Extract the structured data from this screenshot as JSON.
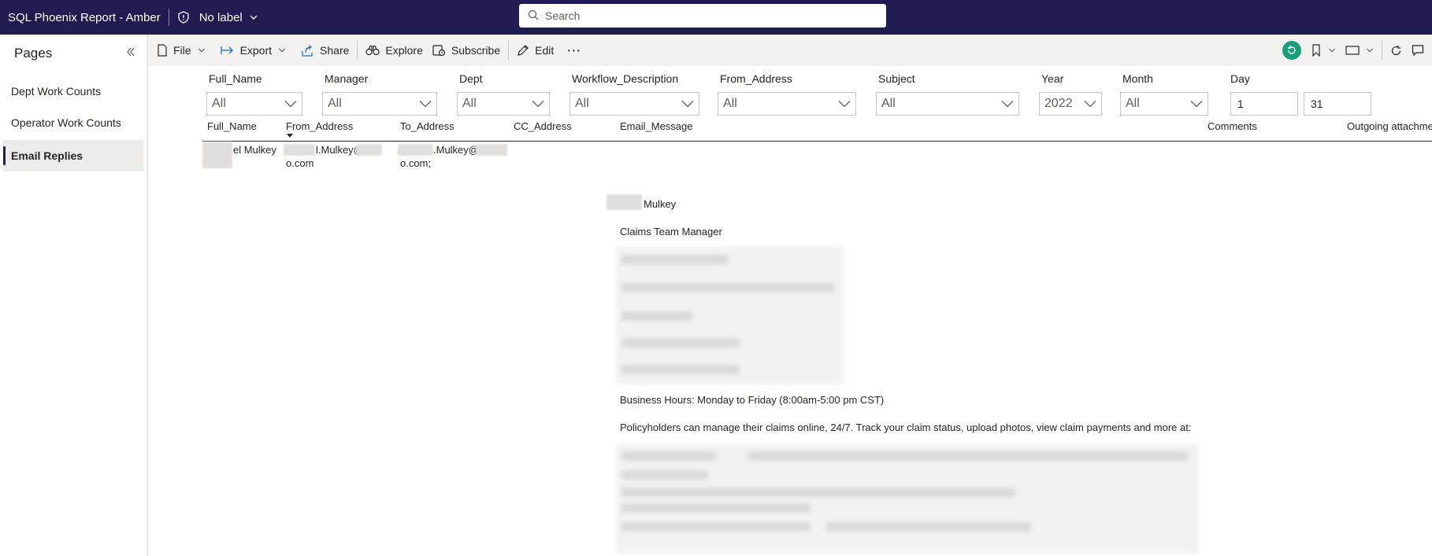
{
  "topbar": {
    "app_title": "SQL Phoenix Report - Amber",
    "sensitivity_label": "No label",
    "search_placeholder": "Search"
  },
  "pages_pane": {
    "title": "Pages",
    "items": [
      {
        "label": "Dept Work Counts",
        "active": false
      },
      {
        "label": "Operator Work Counts",
        "active": false
      },
      {
        "label": "Email Replies",
        "active": true
      }
    ]
  },
  "toolbar": {
    "file": "File",
    "export": "Export",
    "share": "Share",
    "explore": "Explore",
    "subscribe": "Subscribe",
    "edit": "Edit",
    "more": "⋯"
  },
  "slicers": [
    {
      "label": "Full_Name",
      "value": "All"
    },
    {
      "label": "Manager",
      "value": "All"
    },
    {
      "label": "Dept",
      "value": "All"
    },
    {
      "label": "Workflow_Description",
      "value": "All"
    },
    {
      "label": "From_Address",
      "value": "All"
    },
    {
      "label": "Subject",
      "value": "All"
    },
    {
      "label": "Year",
      "value": "2022"
    },
    {
      "label": "Month",
      "value": "All"
    },
    {
      "label": "Day",
      "from": "1",
      "to": "31"
    }
  ],
  "table": {
    "columns": [
      "Full_Name",
      "From_Address",
      "To_Address",
      "CC_Address",
      "Email_Message",
      "Comments",
      "Outgoing attachme"
    ],
    "row": {
      "full_name": "el Mulkey",
      "from_address_1": "l.Mulkey@",
      "from_address_2": "o.com",
      "to_address_1": ".Mulkey@",
      "to_address_2": "o.com;"
    }
  },
  "email_message": {
    "sender_name": "Mulkey",
    "sender_title": "Claims Team Manager",
    "business_hours": "Business Hours: Monday to Friday (8:00am-5:00 pm CST)",
    "policyholders_note": "Policyholders can manage their claims online, 24/7. Track your claim status, upload photos, view claim payments and more at:"
  },
  "colors": {
    "topbar_bg": "#201b50",
    "toolbar_bg": "#f3f2f1",
    "accent_green": "#1a9f7c"
  }
}
